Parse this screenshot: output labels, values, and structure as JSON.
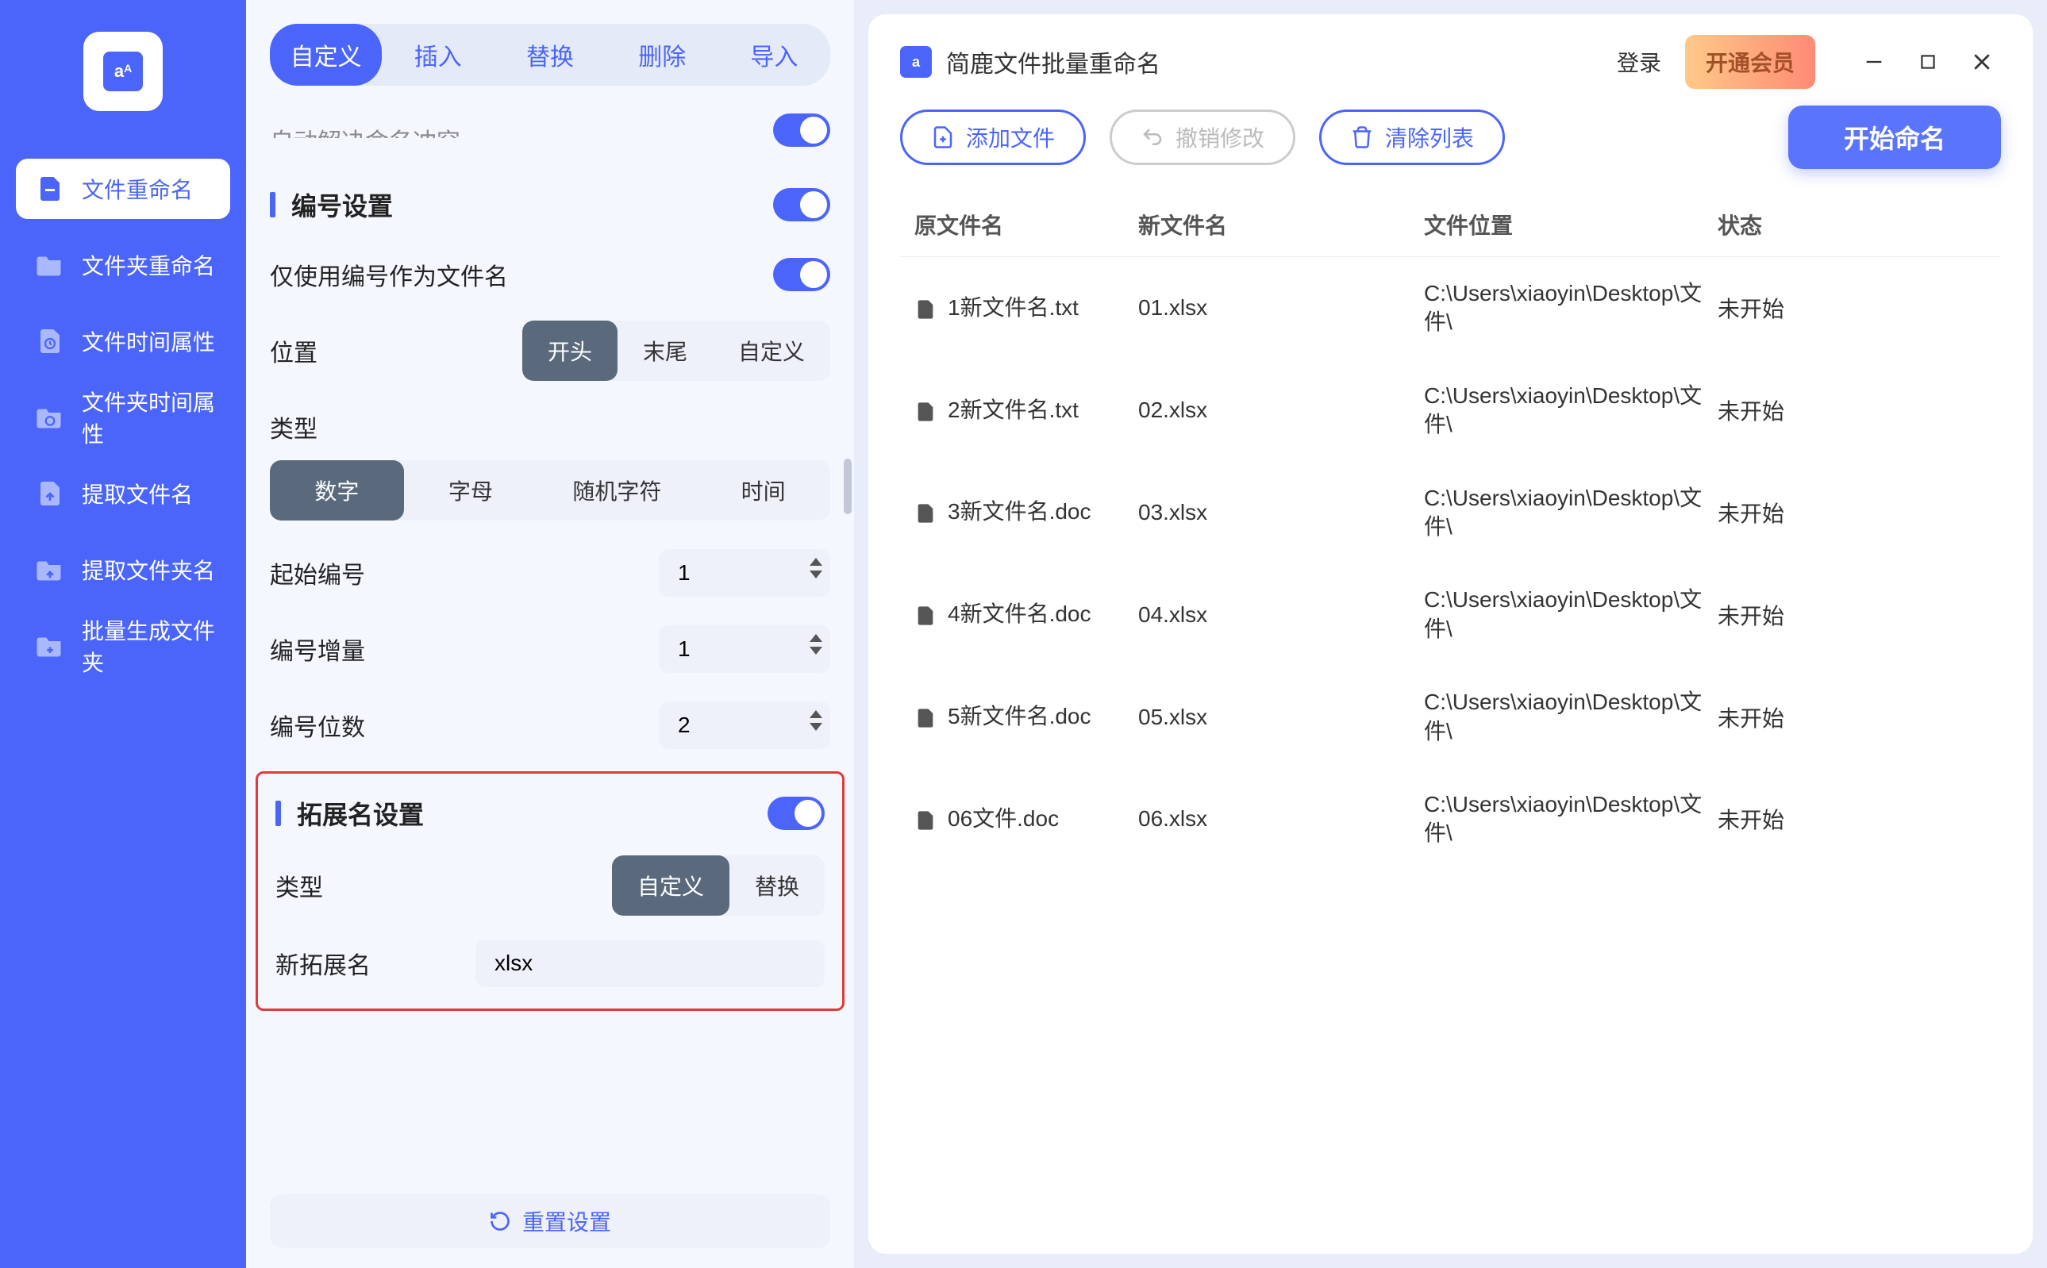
{
  "app": {
    "title": "简鹿文件批量重命名"
  },
  "sidebar": {
    "items": [
      {
        "label": "文件重命名",
        "active": true
      },
      {
        "label": "文件夹重命名",
        "active": false
      },
      {
        "label": "文件时间属性",
        "active": false
      },
      {
        "label": "文件夹时间属性",
        "active": false
      },
      {
        "label": "提取文件名",
        "active": false
      },
      {
        "label": "提取文件夹名",
        "active": false
      },
      {
        "label": "批量生成文件夹",
        "active": false
      }
    ]
  },
  "tabs": [
    "自定义",
    "插入",
    "替换",
    "删除",
    "导入"
  ],
  "settings": {
    "auto_resolve_label": "自动解决命名冲突",
    "numbering_title": "编号设置",
    "only_number_label": "仅使用编号作为文件名",
    "position_label": "位置",
    "position_opts": [
      "开头",
      "末尾",
      "自定义"
    ],
    "type_label": "类型",
    "type_opts": [
      "数字",
      "字母",
      "随机字符",
      "时间"
    ],
    "start_no_label": "起始编号",
    "start_no": "1",
    "step_label": "编号增量",
    "step": "1",
    "digits_label": "编号位数",
    "digits": "2",
    "ext_title": "拓展名设置",
    "ext_type_label": "类型",
    "ext_type_opts": [
      "自定义",
      "替换"
    ],
    "new_ext_label": "新拓展名",
    "new_ext": "xlsx",
    "reset_label": "重置设置"
  },
  "topbar": {
    "login": "登录",
    "vip": "开通会员"
  },
  "actions": {
    "add": "添加文件",
    "undo": "撤销修改",
    "clear": "清除列表",
    "start": "开始命名"
  },
  "table": {
    "headers": [
      "原文件名",
      "新文件名",
      "文件位置",
      "状态"
    ],
    "rows": [
      {
        "orig": "1新文件名.txt",
        "new": "01.xlsx",
        "loc": "C:\\Users\\xiaoyin\\Desktop\\文件\\",
        "stat": "未开始"
      },
      {
        "orig": "2新文件名.txt",
        "new": "02.xlsx",
        "loc": "C:\\Users\\xiaoyin\\Desktop\\文件\\",
        "stat": "未开始"
      },
      {
        "orig": "3新文件名.doc",
        "new": "03.xlsx",
        "loc": "C:\\Users\\xiaoyin\\Desktop\\文件\\",
        "stat": "未开始"
      },
      {
        "orig": "4新文件名.doc",
        "new": "04.xlsx",
        "loc": "C:\\Users\\xiaoyin\\Desktop\\文件\\",
        "stat": "未开始"
      },
      {
        "orig": "5新文件名.doc",
        "new": "05.xlsx",
        "loc": "C:\\Users\\xiaoyin\\Desktop\\文件\\",
        "stat": "未开始"
      },
      {
        "orig": "06文件.doc",
        "new": "06.xlsx",
        "loc": "C:\\Users\\xiaoyin\\Desktop\\文件\\",
        "stat": "未开始"
      }
    ]
  }
}
